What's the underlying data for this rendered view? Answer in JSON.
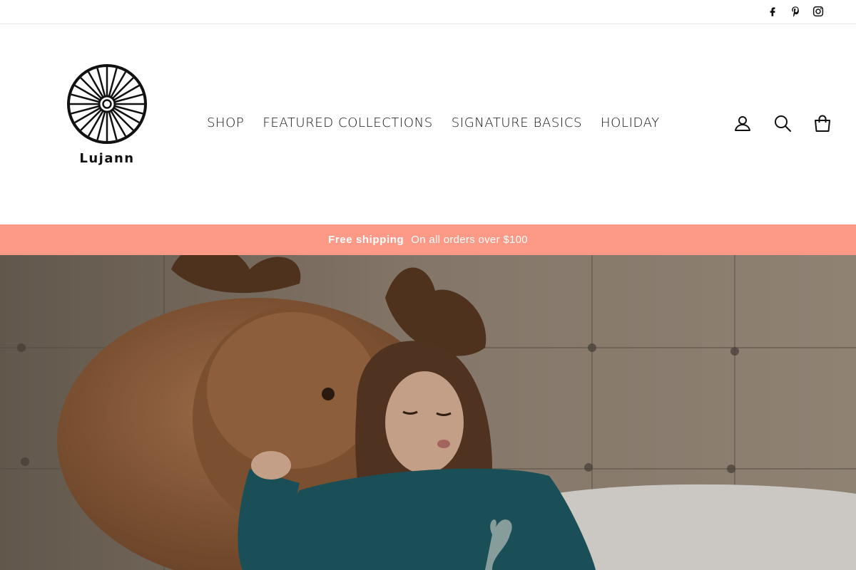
{
  "social": {
    "icons": [
      "facebook-icon",
      "pinterest-icon",
      "instagram-icon"
    ]
  },
  "brand": {
    "name": "Lujann"
  },
  "nav": {
    "items": [
      "SHOP",
      "FEATURED COLLECTIONS",
      "SIGNATURE BASICS",
      "HOLIDAY"
    ]
  },
  "header_icons": [
    "account-icon",
    "search-icon",
    "cart-icon"
  ],
  "announcement": {
    "title": "Free shipping",
    "text": "On all orders over $100",
    "background": "#fc9a87"
  },
  "hero": {
    "image": "woman-with-teddy-moose-photo"
  }
}
